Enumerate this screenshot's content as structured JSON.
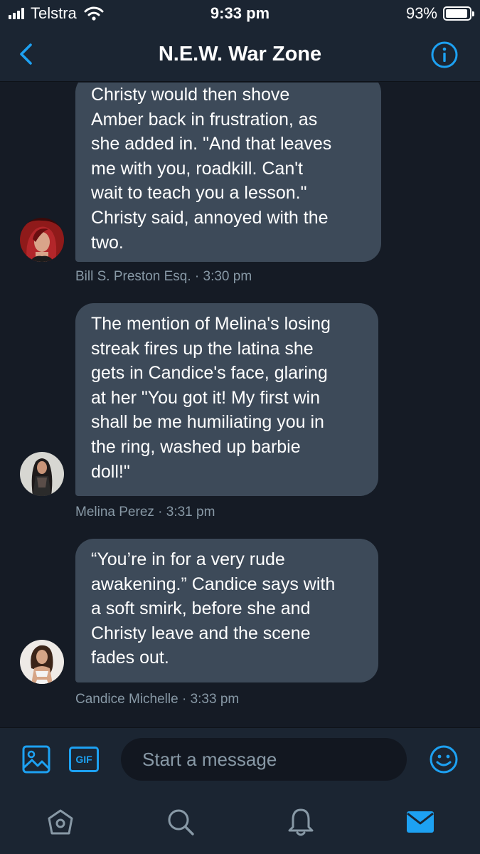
{
  "status_bar": {
    "carrier": "Telstra",
    "time": "9:33 pm",
    "battery_percent": "93%",
    "battery_level": 0.93
  },
  "nav": {
    "title": "N.E.W. War Zone",
    "back_icon": "chevron-left-icon",
    "info_icon": "info-icon"
  },
  "messages": [
    {
      "text": "Christy would then shove\nAmber back in frustration, as\nshe added in.  \"And that leaves\nme with you, roadkill.  Can't\nwait to teach you a lesson.\"\nChristy said, annoyed with the\ntwo.",
      "meta": "Bill S. Preston Esq. · 3:30 pm"
    },
    {
      "text": "The mention of Melina's losing\nstreak fires up the latina she\ngets in Candice's face, glaring\nat her \"You got it! My first win\nshall be me humiliating you in\nthe ring, washed up barbie\ndoll!\"",
      "meta": "Melina Perez · 3:31 pm"
    },
    {
      "text": "“You’re in for a very rude\nawakening.” Candice says with\na soft smirk, before she and\nChristy leave and the scene\nfades out.",
      "meta": "Candice Michelle · 3:33 pm"
    }
  ],
  "composer": {
    "gif_label": "GIF",
    "placeholder": "Start a message",
    "media_icon": "image-icon",
    "emoji_icon": "emoji-icon"
  },
  "tabs": [
    {
      "icon": "home-icon",
      "active": false
    },
    {
      "icon": "search-icon",
      "active": false
    },
    {
      "icon": "bell-icon",
      "active": false
    },
    {
      "icon": "mail-icon",
      "active": true
    }
  ],
  "colors": {
    "accent": "#1da1f2",
    "bubble": "#3d4a59",
    "background": "#151b25",
    "bar": "#1b2532",
    "meta_text": "#8899a6"
  }
}
